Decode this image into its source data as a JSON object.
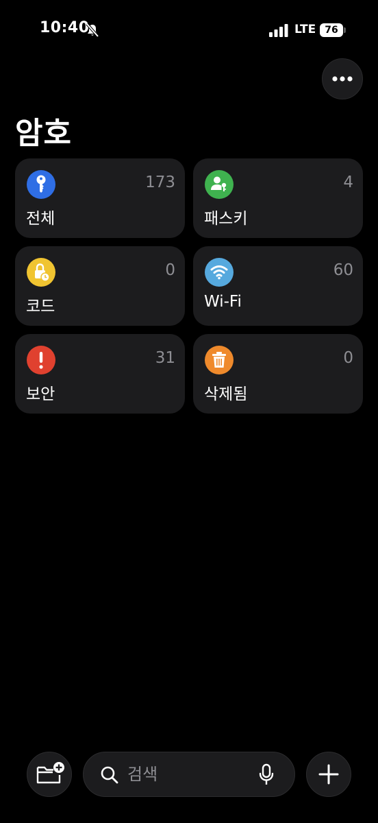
{
  "status_bar": {
    "time": "10:40",
    "network": "LTE",
    "battery": "76",
    "icons": [
      "bell-slash-icon",
      "signal-bars-icon",
      "battery-icon"
    ]
  },
  "header": {
    "title": "암호",
    "more_icon": "ellipsis-icon"
  },
  "categories": [
    {
      "label": "전체",
      "count": "173",
      "icon": "key-icon",
      "color": "#2f6ee5"
    },
    {
      "label": "패스키",
      "count": "4",
      "icon": "person-key-icon",
      "color": "#3fb24f"
    },
    {
      "label": "코드",
      "count": "0",
      "icon": "lock-clock-icon",
      "color": "#f0c431"
    },
    {
      "label": "Wi-Fi",
      "count": "60",
      "icon": "wifi-icon",
      "color": "#56a9de"
    },
    {
      "label": "보안",
      "count": "31",
      "icon": "exclamation-icon",
      "color": "#e0412f"
    },
    {
      "label": "삭제됨",
      "count": "0",
      "icon": "trash-icon",
      "color": "#ef8a2c"
    }
  ],
  "bottom_bar": {
    "folder_icon": "new-folder-icon",
    "search_placeholder": "검색",
    "search_icon": "search-icon",
    "mic_icon": "microphone-icon",
    "add_icon": "plus-icon"
  },
  "colors": {
    "background": "#000000",
    "card": "#1c1c1e",
    "secondary_text": "#8e8e93"
  }
}
